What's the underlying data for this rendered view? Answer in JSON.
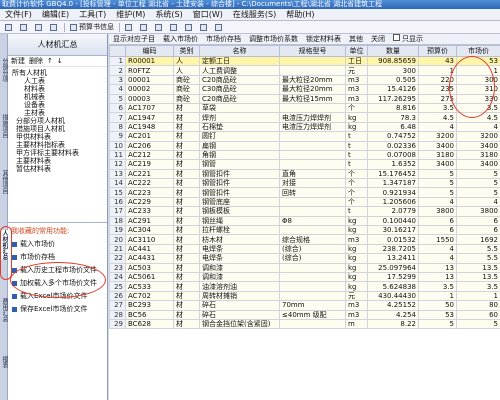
{
  "window": {
    "title": "取费计价软件 GBQ4.0 - [投标管理 - 单位工程 湖北省 - 土建安装 - 综合楼] - C:\\Documents\\工程\\湖北省 湖北省建筑工程"
  },
  "menu": {
    "items": [
      "文件(F)",
      "编辑(E)",
      "工具(T)",
      "维护(M)",
      "系统(S)",
      "窗口(W)",
      "在线服务(S)",
      "帮助(H)"
    ]
  },
  "toolbar": {
    "items": [
      "",
      "",
      "",
      "",
      "预算书信息",
      "",
      "",
      "",
      "",
      "",
      "",
      "",
      "",
      "",
      ""
    ],
    "preview_label": "预算书信息"
  },
  "vtabs": [
    "分部分项",
    "措施项目",
    "其他项目",
    "人材机汇总",
    "费用汇总",
    "报表"
  ],
  "left_panel": {
    "title": "人材机汇总",
    "tools": [
      "新建",
      "删除",
      "↑",
      "↓"
    ],
    "tree": [
      "所有人材机",
      "人工表",
      "材料表",
      "机械表",
      "设备表",
      "主材表",
      "分部分项人材机",
      "措施项目人材机",
      "甲供材料表",
      "主要材料指标表",
      "甲方评标主要材料表",
      "主要材料表",
      "暂估材料表"
    ],
    "fav_title": "我收藏的常用功能:",
    "favorites": [
      "载入市场价",
      "市场价存档",
      "载入历史工程市场价文件",
      "加权载入多个市场价文件",
      "载入Excel市场价文件",
      "保存Excel市场价文件"
    ]
  },
  "grid_toolbar": {
    "items": [
      "显示对应子目",
      "载入市场价",
      "市场价存档",
      "调整市场价系数",
      "",
      "锁定材料表",
      "其他",
      "关闭"
    ],
    "checkbox_label": "只显示"
  },
  "grid": {
    "columns": [
      "",
      "编码",
      "类别",
      "名称",
      "规格型号",
      "单位",
      "数量",
      "预算价",
      "市场价"
    ],
    "rows": [
      [
        "1",
        "R00001",
        "人",
        "定额工日",
        "",
        "工日",
        "908.85659",
        "43",
        "53"
      ],
      [
        "2",
        "R0FTZ",
        "人",
        "人工费调整",
        "",
        "元",
        "300",
        "1",
        "1"
      ],
      [
        "3",
        "00001",
        "商砼",
        "C20商品砼",
        "最大粒径20mm",
        "m3",
        "0.505",
        "220",
        "300"
      ],
      [
        "4",
        "00002",
        "商砼",
        "C30商品砼",
        "最大粒径20mm",
        "m3",
        "15.4126",
        "235",
        "310"
      ],
      [
        "5",
        "00003",
        "商砼",
        "C20商品砼",
        "最大粒径15mm",
        "m3",
        "117.26295",
        "275",
        "330"
      ],
      [
        "6",
        "AC1707",
        "材",
        "草袋",
        "",
        "个",
        "8.816",
        "3.5",
        "3.5"
      ],
      [
        "7",
        "AC1947",
        "材",
        "焊剂",
        "电渣压力焊焊剂",
        "kg",
        "78.3",
        "4.5",
        "4.5"
      ],
      [
        "8",
        "AC1948",
        "材",
        "石棉垫",
        "电渣压力焊焊剂",
        "kg",
        "6.48",
        "4",
        "4"
      ],
      [
        "9",
        "AC201",
        "材",
        "圆钉",
        "",
        "t",
        "0.74752",
        "3200",
        "3200"
      ],
      [
        "10",
        "AC206",
        "材",
        "扁钢",
        "",
        "t",
        "0.02336",
        "3400",
        "3400"
      ],
      [
        "11",
        "AC212",
        "材",
        "角钢",
        "",
        "t",
        "0.07008",
        "3180",
        "3180"
      ],
      [
        "12",
        "AC219",
        "材",
        "钢管",
        "",
        "t",
        "1.6352",
        "3400",
        "3400"
      ],
      [
        "13",
        "AC221",
        "材",
        "钢管扣件",
        "直角",
        "个",
        "15.176452",
        "5",
        "5"
      ],
      [
        "14",
        "AC222",
        "材",
        "钢管扣件",
        "对接",
        "个",
        "1.347187",
        "5",
        "5"
      ],
      [
        "15",
        "AC223",
        "材",
        "钢管扣件",
        "回转",
        "个",
        "0.921934",
        "5",
        "5"
      ],
      [
        "16",
        "AC229",
        "材",
        "钢管底座",
        "",
        "个",
        "1.205606",
        "4",
        "4"
      ],
      [
        "17",
        "AC233",
        "材",
        "钢板模板",
        "",
        "t",
        "2.0779",
        "3800",
        "3800"
      ],
      [
        "18",
        "AC291",
        "材",
        "钢丝绳",
        "Φ8",
        "kg",
        "0.100440",
        "6",
        "6"
      ],
      [
        "19",
        "AC304",
        "材",
        "拉杆螺栓",
        "",
        "kg",
        "30.16217",
        "6",
        "6"
      ],
      [
        "20",
        "AC3110",
        "材",
        "枋木材",
        "综合规格",
        "m3",
        "0.01532",
        "1550",
        "1692"
      ],
      [
        "21",
        "AC441",
        "材",
        "电焊条",
        "(综合)",
        "kg",
        "238.7205",
        "4",
        "5.5"
      ],
      [
        "22",
        "AC4431",
        "材",
        "电焊条",
        "(综合)",
        "kg",
        "13.2411",
        "4",
        "5.5"
      ],
      [
        "23",
        "AC503",
        "材",
        "调和漆",
        "",
        "kg",
        "25.097964",
        "13",
        "13.5"
      ],
      [
        "24",
        "AC5061",
        "材",
        "调和漆",
        "",
        "kg",
        "17.5299",
        "13",
        "13.5"
      ],
      [
        "25",
        "AC533",
        "材",
        "油漆溶剂油",
        "",
        "kg",
        "5.624838",
        "3.5",
        "3.5"
      ],
      [
        "26",
        "AC702",
        "材",
        "周转材摊销",
        "",
        "元",
        "430.44430",
        "1",
        "1"
      ],
      [
        "27",
        "BC293",
        "材",
        "碎石",
        "70mm",
        "m3",
        "4.25152",
        "50",
        "80"
      ],
      [
        "28",
        "BC56",
        "材",
        "碎石",
        "≤40mm 级配",
        "m3",
        "4.254",
        "53",
        "60"
      ],
      [
        "29",
        "BC628",
        "材",
        "钢合金挡位架(含紧固)",
        "",
        "m",
        "8.22",
        "5",
        "5"
      ]
    ]
  },
  "colors": {
    "title_bar": "#2e66b6",
    "selected_row": "#fff5a8",
    "annotation": "#e23a2a",
    "favorites_heading": "#d4471d"
  }
}
